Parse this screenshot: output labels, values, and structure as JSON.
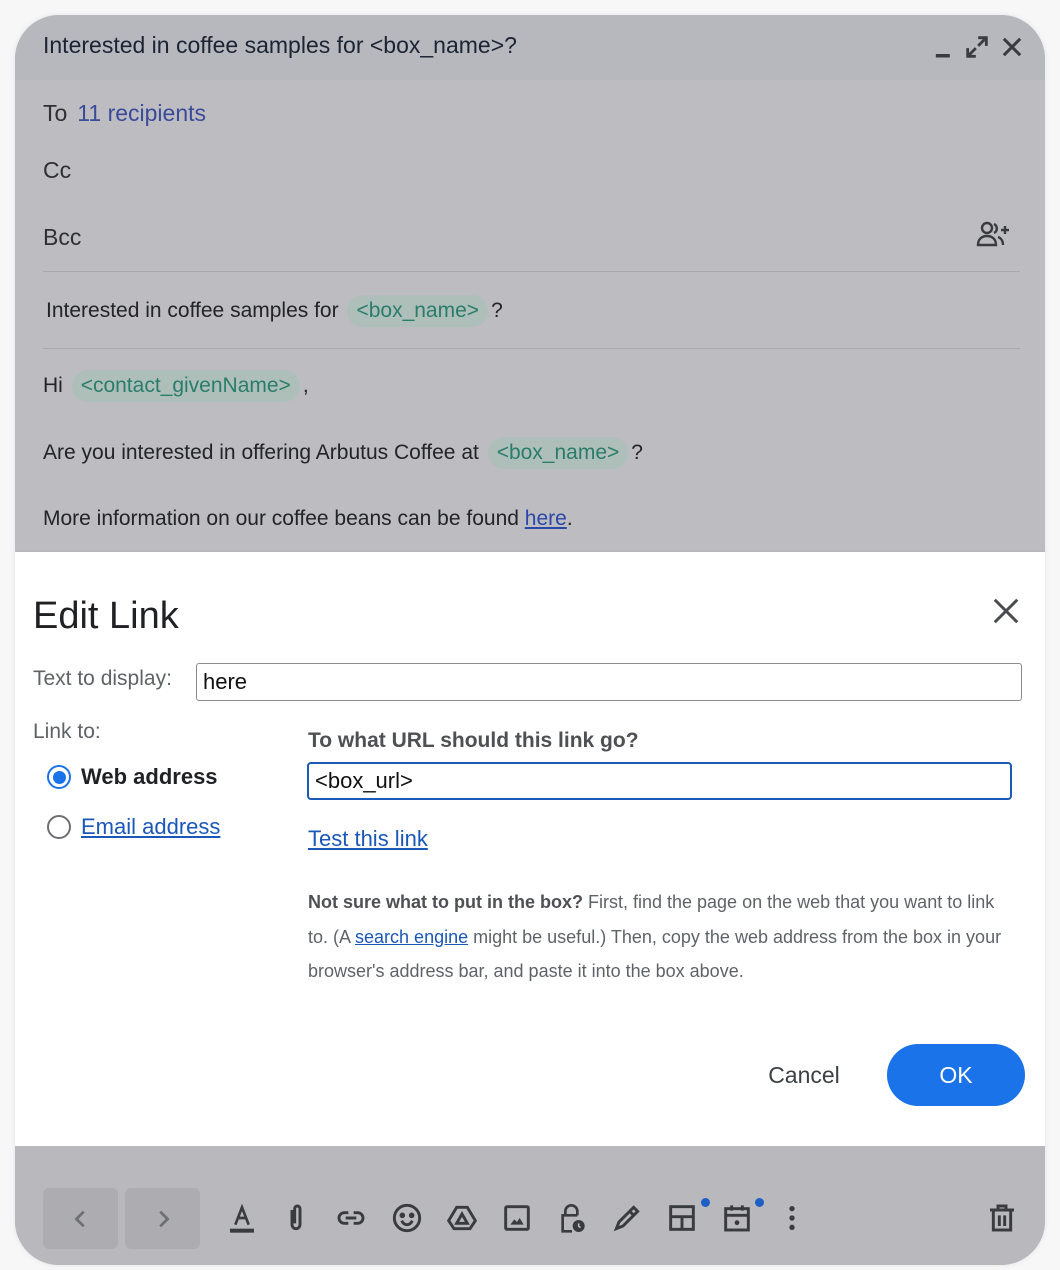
{
  "compose": {
    "title": "Interested in coffee samples for <box_name>?",
    "window_controls": [
      "minimize-icon",
      "expand-icon",
      "close-icon"
    ],
    "to_label": "To",
    "to_value": "11 recipients",
    "cc_label": "Cc",
    "bcc_label": "Bcc",
    "add_recipients_icon": "people-add-icon",
    "subject": {
      "prefix": "Interested in coffee samples for",
      "chip": "<box_name>",
      "suffix": "?"
    },
    "body": {
      "greeting_prefix": "Hi",
      "greeting_chip": "<contact_givenName>",
      "greeting_suffix": ",",
      "line2_prefix": "Are you interested in offering Arbutus Coffee at",
      "line2_chip": "<box_name>",
      "line2_suffix": "?",
      "line3_prefix": "More information on our coffee beans can be found",
      "line3_link": "here",
      "line3_suffix": "."
    }
  },
  "dialog": {
    "title": "Edit Link",
    "close_icon": "close-icon",
    "text_to_display_label": "Text to display:",
    "text_to_display_value": "here",
    "link_to_label": "Link to:",
    "options": [
      {
        "label": "Web address",
        "selected": true
      },
      {
        "label": "Email address",
        "selected": false
      }
    ],
    "url_heading": "To what URL should this link go?",
    "url_value": "<box_url>",
    "test_link": "Test this link",
    "help": {
      "bold": "Not sure what to put in the box?",
      "part1": " First, find the page on the web that you want to link to. (A ",
      "link": "search engine",
      "part2": " might be useful.) Then, copy the web address from the box in your browser's address bar, and paste it into the box above."
    },
    "cancel_label": "Cancel",
    "ok_label": "OK",
    "accent_color": "#1a73e8"
  },
  "toolbar": {
    "nav": [
      "chevron-left-icon",
      "chevron-right-icon"
    ],
    "icons": [
      "text-format-icon",
      "attach-icon",
      "link-icon",
      "emoji-icon",
      "drive-icon",
      "image-icon",
      "confidential-lock-icon",
      "signature-pen-icon",
      "layout-template-icon",
      "schedule-calendar-icon",
      "more-options-icon",
      "trash-icon"
    ],
    "badges_on": [
      "layout-template-icon",
      "schedule-calendar-icon"
    ]
  }
}
